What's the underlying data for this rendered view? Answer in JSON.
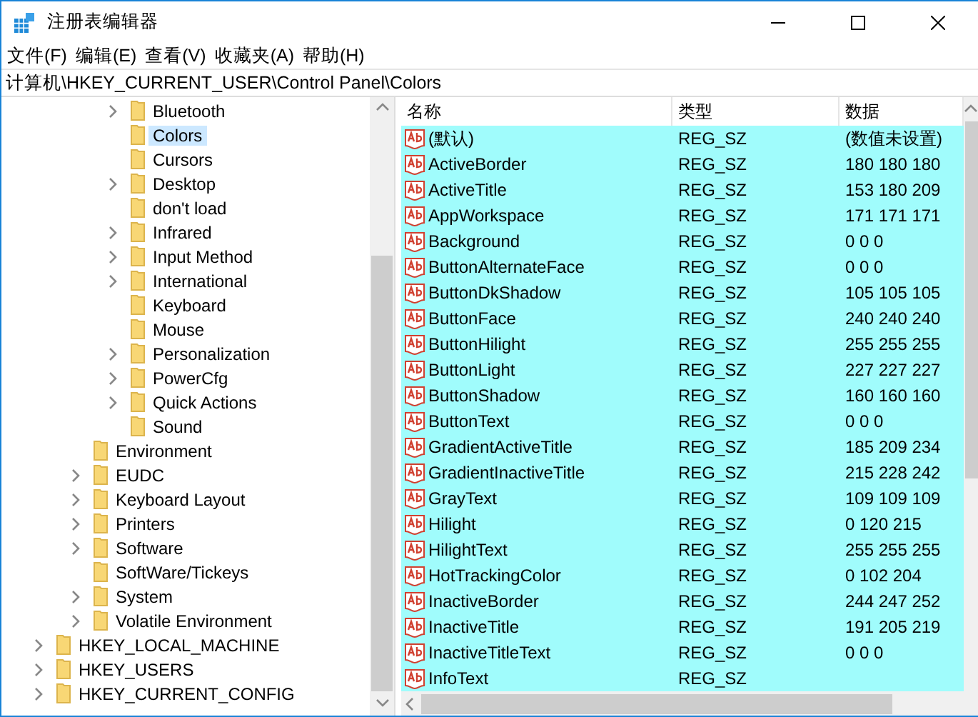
{
  "window": {
    "title": "注册表编辑器"
  },
  "menu": [
    "文件(F)",
    "编辑(E)",
    "查看(V)",
    "收藏夹(A)",
    "帮助(H)"
  ],
  "address": "计算机\\HKEY_CURRENT_USER\\Control Panel\\Colors",
  "tree": [
    {
      "children": [
        {
          "children": [
            {
              "label": "Bluetooth",
              "expandable": true,
              "selected": false
            },
            {
              "label": "Colors",
              "expandable": false,
              "selected": true
            },
            {
              "label": "Cursors",
              "expandable": false,
              "selected": false
            },
            {
              "label": "Desktop",
              "expandable": true,
              "selected": false
            },
            {
              "label": "don't load",
              "expandable": false,
              "selected": false
            },
            {
              "label": "Infrared",
              "expandable": true,
              "selected": false
            },
            {
              "label": "Input Method",
              "expandable": true,
              "selected": false
            },
            {
              "label": "International",
              "expandable": true,
              "selected": false
            },
            {
              "label": "Keyboard",
              "expandable": false,
              "selected": false
            },
            {
              "label": "Mouse",
              "expandable": false,
              "selected": false
            },
            {
              "label": "Personalization",
              "expandable": true,
              "selected": false
            },
            {
              "label": "PowerCfg",
              "expandable": true,
              "selected": false
            },
            {
              "label": "Quick Actions",
              "expandable": true,
              "selected": false
            },
            {
              "label": "Sound",
              "expandable": false,
              "selected": false
            }
          ]
        },
        {
          "label": "Environment",
          "expandable": false,
          "selected": false
        },
        {
          "label": "EUDC",
          "expandable": true,
          "selected": false
        },
        {
          "label": "Keyboard Layout",
          "expandable": true,
          "selected": false
        },
        {
          "label": "Printers",
          "expandable": true,
          "selected": false
        },
        {
          "label": "Software",
          "expandable": true,
          "selected": false
        },
        {
          "label": "SoftWare/Tickeys",
          "expandable": false,
          "selected": false
        },
        {
          "label": "System",
          "expandable": true,
          "selected": false
        },
        {
          "label": "Volatile Environment",
          "expandable": true,
          "selected": false
        }
      ]
    },
    {
      "label": "HKEY_LOCAL_MACHINE",
      "expandable": true,
      "selected": false
    },
    {
      "label": "HKEY_USERS",
      "expandable": true,
      "selected": false
    },
    {
      "label": "HKEY_CURRENT_CONFIG",
      "expandable": true,
      "selected": false
    }
  ],
  "table": {
    "columns": [
      "名称",
      "类型",
      "数据"
    ],
    "rows": [
      {
        "name": "(默认)",
        "type": "REG_SZ",
        "data": "(数值未设置)",
        "selected": true
      },
      {
        "name": "ActiveBorder",
        "type": "REG_SZ",
        "data": "180 180 180",
        "selected": true
      },
      {
        "name": "ActiveTitle",
        "type": "REG_SZ",
        "data": "153 180 209",
        "selected": true
      },
      {
        "name": "AppWorkspace",
        "type": "REG_SZ",
        "data": "171 171 171",
        "selected": true
      },
      {
        "name": "Background",
        "type": "REG_SZ",
        "data": "0 0 0",
        "selected": true
      },
      {
        "name": "ButtonAlternateFace",
        "type": "REG_SZ",
        "data": "0 0 0",
        "selected": true
      },
      {
        "name": "ButtonDkShadow",
        "type": "REG_SZ",
        "data": "105 105 105",
        "selected": true
      },
      {
        "name": "ButtonFace",
        "type": "REG_SZ",
        "data": "240 240 240",
        "selected": true
      },
      {
        "name": "ButtonHilight",
        "type": "REG_SZ",
        "data": "255 255 255",
        "selected": true
      },
      {
        "name": "ButtonLight",
        "type": "REG_SZ",
        "data": "227 227 227",
        "selected": true
      },
      {
        "name": "ButtonShadow",
        "type": "REG_SZ",
        "data": "160 160 160",
        "selected": true
      },
      {
        "name": "ButtonText",
        "type": "REG_SZ",
        "data": "0 0 0",
        "selected": true
      },
      {
        "name": "GradientActiveTitle",
        "type": "REG_SZ",
        "data": "185 209 234",
        "selected": true
      },
      {
        "name": "GradientInactiveTitle",
        "type": "REG_SZ",
        "data": "215 228 242",
        "selected": true
      },
      {
        "name": "GrayText",
        "type": "REG_SZ",
        "data": "109 109 109",
        "selected": true
      },
      {
        "name": "Hilight",
        "type": "REG_SZ",
        "data": "0 120 215",
        "selected": true
      },
      {
        "name": "HilightText",
        "type": "REG_SZ",
        "data": "255 255 255",
        "selected": true
      },
      {
        "name": "HotTrackingColor",
        "type": "REG_SZ",
        "data": "0 102 204",
        "selected": true
      },
      {
        "name": "InactiveBorder",
        "type": "REG_SZ",
        "data": "244 247 252",
        "selected": true
      },
      {
        "name": "InactiveTitle",
        "type": "REG_SZ",
        "data": "191 205 219",
        "selected": true
      },
      {
        "name": "InactiveTitleText",
        "type": "REG_SZ",
        "data": "0 0 0",
        "selected": true
      },
      {
        "name": "InfoText",
        "type": "REG_SZ",
        "selected": true
      }
    ]
  }
}
